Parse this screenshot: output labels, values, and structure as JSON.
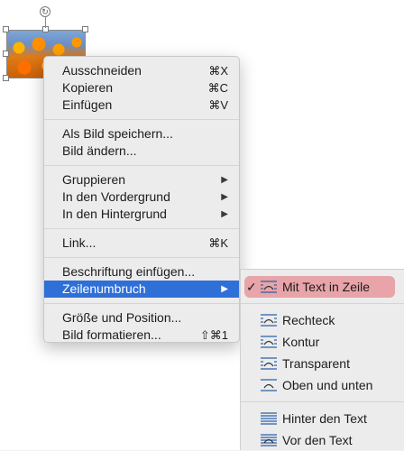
{
  "image": {
    "alt_icon": "flowers-photo"
  },
  "context_menu": {
    "groups": [
      [
        {
          "label": "Ausschneiden",
          "shortcut": "⌘X"
        },
        {
          "label": "Kopieren",
          "shortcut": "⌘C"
        },
        {
          "label": "Einfügen",
          "shortcut": "⌘V"
        }
      ],
      [
        {
          "label": "Als Bild speichern..."
        },
        {
          "label": "Bild ändern..."
        }
      ],
      [
        {
          "label": "Gruppieren",
          "arrow": "▶"
        },
        {
          "label": "In den Vordergrund",
          "arrow": "▶"
        },
        {
          "label": "In den Hintergrund",
          "arrow": "▶"
        }
      ],
      [
        {
          "label": "Link...",
          "shortcut": "⌘K"
        }
      ],
      [
        {
          "label": "Beschriftung einfügen..."
        },
        {
          "label": "Zeilenumbruch",
          "arrow": "▶"
        }
      ],
      [
        {
          "label": "Größe und Position..."
        },
        {
          "label": "Bild formatieren...",
          "shortcut": "⇧⌘1"
        }
      ]
    ]
  },
  "wrap_submenu": {
    "checkmark": "✓",
    "groups": [
      [
        {
          "label": "Mit Text in Zeile",
          "icon": "inline-wrap-icon",
          "checked": true
        }
      ],
      [
        {
          "label": "Rechteck",
          "icon": "square-wrap-icon"
        },
        {
          "label": "Kontur",
          "icon": "tight-wrap-icon"
        },
        {
          "label": "Transparent",
          "icon": "through-wrap-icon"
        },
        {
          "label": "Oben und unten",
          "icon": "top-bottom-wrap-icon"
        }
      ],
      [
        {
          "label": "Hinter den Text",
          "icon": "behind-text-icon"
        },
        {
          "label": "Vor den Text",
          "icon": "in-front-text-icon"
        }
      ]
    ]
  },
  "colors": {
    "highlight": "#2f6fd8",
    "submenu_highlight": "#e8a4a8"
  }
}
